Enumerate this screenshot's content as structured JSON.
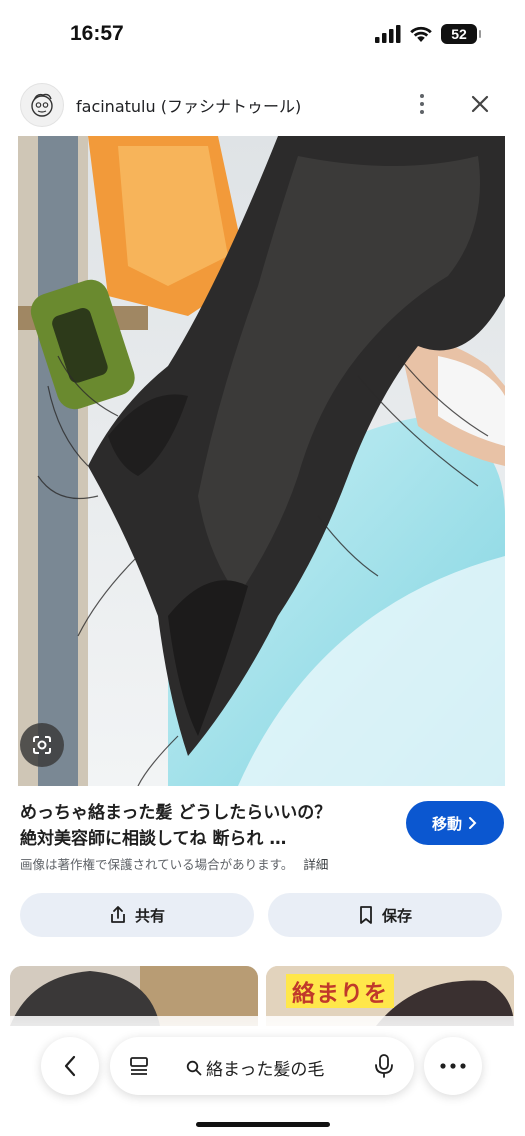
{
  "status": {
    "time": "16:57",
    "battery": "52"
  },
  "source": {
    "name": "facinatulu (ファシナトゥール)"
  },
  "result": {
    "title_line1": "めっちゃ絡まった髪 どうしたらいいの？",
    "title_line2": "絶対美容師に相談してね 断られ …",
    "copyright_notice": "画像は著作権で保護されている場合があります。",
    "detail_label": "詳細",
    "visit_label": "移動"
  },
  "actions": {
    "share_label": "共有",
    "save_label": "保存"
  },
  "thumbnails": {
    "second_caption": "絡まりを"
  },
  "searchbar": {
    "query": "絡まった髪の毛"
  },
  "colors": {
    "accent": "#0b57d0",
    "action_bg": "#e9eef6"
  }
}
